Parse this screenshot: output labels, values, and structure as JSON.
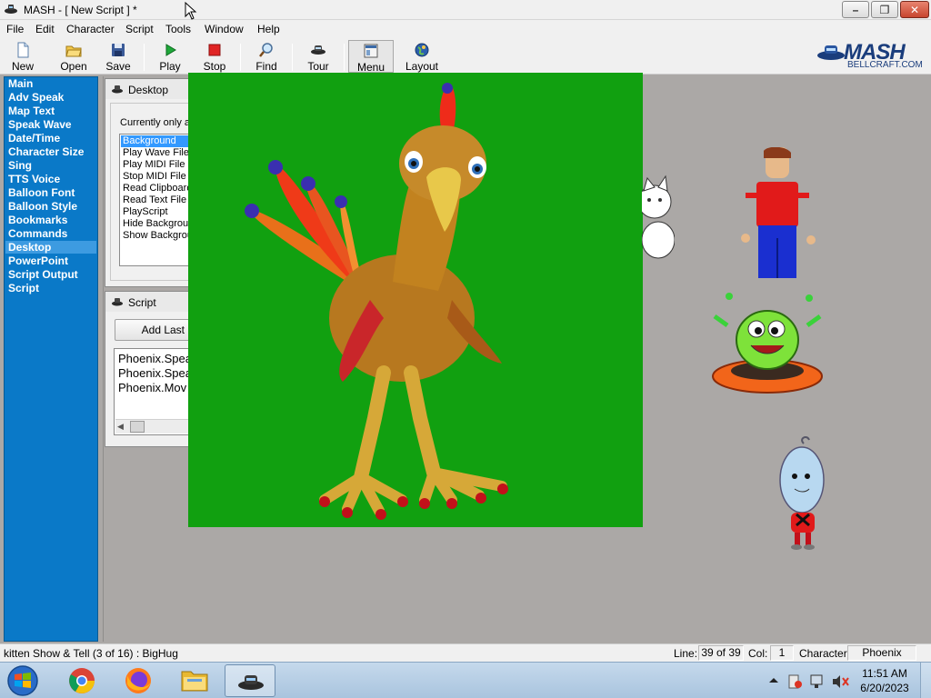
{
  "window": {
    "title": "MASH - [ New Script ] *",
    "minimize": "–",
    "maximize": "❐",
    "close": "✕"
  },
  "menu": [
    "File",
    "Edit",
    "Character",
    "Script",
    "Tools",
    "Window",
    "Help"
  ],
  "toolbar": {
    "new": "New",
    "open": "Open",
    "save": "Save",
    "play": "Play",
    "stop": "Stop",
    "find": "Find",
    "tour": "Tour",
    "menu": "Menu",
    "layout": "Layout"
  },
  "brand": {
    "logo": "MASH",
    "site": "BELLCRAFT.COM"
  },
  "sidebar": {
    "items": [
      "Main",
      "Adv Speak",
      "Map Text",
      "Speak Wave",
      "Date/Time",
      "Character Size",
      "Sing",
      "TTS Voice",
      "Balloon Font",
      "Balloon Style",
      "Bookmarks",
      "Commands",
      "Desktop",
      "PowerPoint",
      "Script Output",
      "Script"
    ],
    "selected": "Desktop"
  },
  "desktop_window": {
    "title": "Desktop",
    "label": "Currently only av",
    "list": [
      "Background",
      "Play Wave File",
      "Play MIDI File",
      "Stop MIDI File",
      "Read Clipboard",
      "Read Text File",
      "PlayScript",
      "Hide Backgroun",
      "Show Backgrou"
    ],
    "selected": "Background"
  },
  "script_window": {
    "title": "Script",
    "add_button": "Add Last M",
    "lines": [
      "Phoenix.Spea",
      "Phoenix.Spea",
      "Phoenix.Mov"
    ]
  },
  "status": {
    "message": "kitten Show & Tell (3 of 16) : BigHug",
    "line_label": "Line:",
    "line_value": "39 of 39",
    "col_label": "Col:",
    "col_value": "1",
    "char_label": "Character:",
    "char_value": "Phoenix"
  },
  "taskbar": {
    "time": "11:51 AM",
    "date": "6/20/2023"
  },
  "colors": {
    "stage": "#11a010",
    "sidebar": "#0a79c8",
    "desktop": "#aba8a6"
  }
}
